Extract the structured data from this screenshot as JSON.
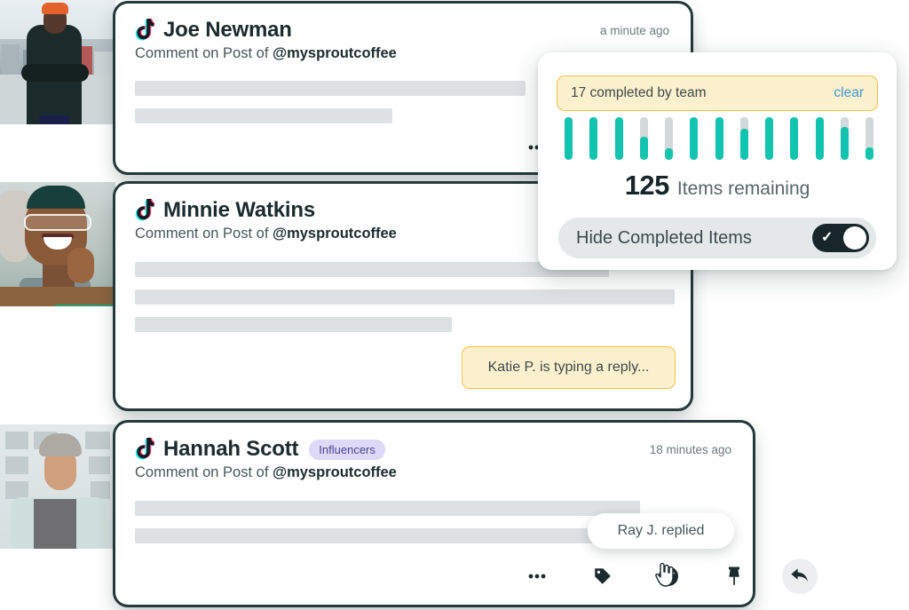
{
  "cards": [
    {
      "network_icon": "tiktok-icon",
      "author": "Joe Newman",
      "badge": null,
      "time": "a minute ago",
      "subline_prefix": "Comment on Post of ",
      "subline_handle": "@mysproutcoffee",
      "skeleton_widths": [
        440,
        290
      ],
      "actions": [
        "ellipsis-icon",
        "tag-icon"
      ]
    },
    {
      "network_icon": "tiktok-icon",
      "author": "Minnie Watkins",
      "badge": null,
      "time": "",
      "subline_prefix": "Comment on Post of ",
      "subline_handle": "@mysproutcoffee",
      "skeleton_widths": [
        534,
        608,
        357
      ],
      "actions": []
    },
    {
      "network_icon": "tiktok-icon",
      "author": "Hannah Scott",
      "badge": "Influencers",
      "time": "18 minutes ago",
      "subline_prefix": "Comment on Post of ",
      "subline_handle": "@mysproutcoffee",
      "skeleton_widths": [
        569,
        610
      ],
      "actions": [
        "ellipsis-icon",
        "tag-icon",
        "check-circle-icon",
        "pin-icon",
        "reply-icon"
      ]
    }
  ],
  "stats_panel": {
    "banner_text": "17 completed by team",
    "clear_label": "clear",
    "remaining_number": "125",
    "remaining_label": "Items remaining",
    "toggle_label": "Hide Completed Items",
    "toggle_state": "on",
    "toggle_icon": "check-icon"
  },
  "bubbles": {
    "typing": "Katie P. is typing a reply...",
    "reply": "Ray J. replied"
  },
  "colors": {
    "teal_fill": "#12c4b0",
    "bar_track": "#d3d8da",
    "banner_bg": "#fdf0cd",
    "banner_border": "#f2c14a",
    "clear_link": "#3c9ad6",
    "badge_bg": "#ddd9f7",
    "badge_text": "#4b4593",
    "card_outline": "#24393a",
    "skeleton": "#dde1e3",
    "toggle_on": "#17262a"
  },
  "chart_data": {
    "type": "bar",
    "title": "17 completed by team",
    "categories": [
      "1",
      "2",
      "3",
      "4",
      "5",
      "6",
      "7",
      "8",
      "9",
      "10",
      "11",
      "12",
      "13"
    ],
    "values": [
      100,
      100,
      100,
      55,
      28,
      100,
      100,
      72,
      100,
      100,
      100,
      78,
      30
    ],
    "series": [
      {
        "name": "completed",
        "values": [
          100,
          100,
          100,
          55,
          28,
          100,
          100,
          72,
          100,
          100,
          100,
          78,
          30
        ]
      }
    ],
    "value_unit": "percent-filled",
    "track_max": 100,
    "xlabel": "",
    "ylabel": "",
    "ylim": [
      0,
      100
    ],
    "grid": false,
    "legend": "none",
    "annotations": [
      "125 Items remaining"
    ]
  },
  "photos": [
    {
      "alt": "man-in-orange-beanie-photo"
    },
    {
      "alt": "smiling-woman-with-glasses-photo"
    },
    {
      "alt": "woman-in-grey-beanie-photo"
    }
  ]
}
